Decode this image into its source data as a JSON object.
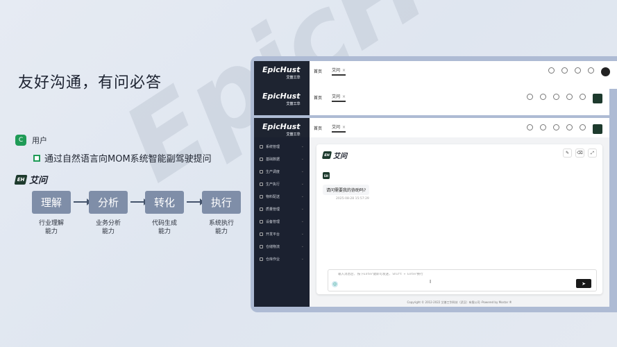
{
  "slide": {
    "title": "友好沟通，有问必答",
    "user_badge": "C",
    "user_label": "用户",
    "description": "通过自然语言向MOM系统智能副驾驶提问",
    "ai_name": "艾问",
    "ai_badge": "EH",
    "watermark": "EpicHust",
    "flow": [
      {
        "label": "理解",
        "caption_line1": "行业理解",
        "caption_line2": "能力"
      },
      {
        "label": "分析",
        "caption_line1": "业务分析",
        "caption_line2": "能力"
      },
      {
        "label": "转化",
        "caption_line1": "代码生成",
        "caption_line2": "能力"
      },
      {
        "label": "执行",
        "caption_line1": "系统执行",
        "caption_line2": "能力"
      }
    ]
  },
  "app": {
    "brand": "EpicHust",
    "brand_sub": "艾普工华",
    "tabs": {
      "home": "首页",
      "ai": "艾问",
      "close": "×"
    },
    "menu": [
      "系统管理",
      "基础数据",
      "生产调度",
      "生产执行",
      "物料配送",
      "质量管理",
      "设备管理",
      "开发平台",
      "仓储物流",
      "仓库作业"
    ],
    "chat": {
      "title": "艾问",
      "bot_badge": "EH",
      "greeting": "请问需要我的协助吗?",
      "timestamp": "2025-08-28 15:57:29",
      "placeholder": "输入消息后, 按下Enter键即可发送, Shift + Enter换行",
      "send_icon": "send-icon",
      "cursor": "I"
    },
    "footer": "Copyright © 2012-2022 艾普工华科技（武汉）有限公司 ·Powered by Mostar ®",
    "colors": {
      "sidebar": "#1b2130",
      "accent_green": "#1f9b57",
      "step": "#7f8ea8"
    }
  }
}
